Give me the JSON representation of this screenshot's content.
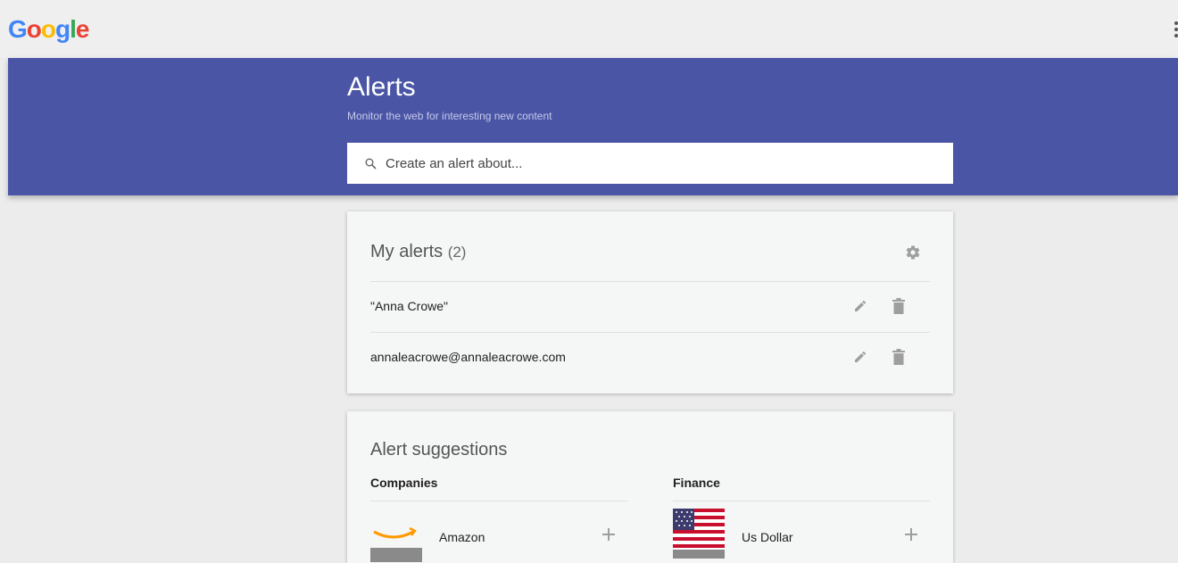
{
  "logo": {
    "letters": [
      "G",
      "o",
      "o",
      "g",
      "l",
      "e"
    ],
    "colors": [
      "#4285F4",
      "#EA4335",
      "#FBBC05",
      "#4285F4",
      "#34A853",
      "#EA4335"
    ]
  },
  "banner": {
    "title": "Alerts",
    "subtitle": "Monitor the web for interesting new content",
    "color": "#4a55a6"
  },
  "search": {
    "placeholder": "Create an alert about...",
    "icon": "search-icon"
  },
  "my_alerts": {
    "title": "My alerts",
    "count": "(2)",
    "settings_icon": "gear-icon",
    "items": [
      {
        "query": "\"Anna Crowe\"",
        "edit_icon": "pencil-icon",
        "delete_icon": "trash-icon"
      },
      {
        "query": "annaleacrowe@annaleacrowe.com",
        "edit_icon": "pencil-icon",
        "delete_icon": "trash-icon"
      }
    ]
  },
  "suggestions": {
    "title": "Alert suggestions",
    "columns": [
      {
        "heading": "Companies",
        "items": [
          {
            "name": "Amazon",
            "thumb": "amazon-logo"
          }
        ]
      },
      {
        "heading": "Finance",
        "items": [
          {
            "name": "Us Dollar",
            "thumb": "us-flag"
          }
        ]
      }
    ],
    "add_icon": "plus-icon"
  }
}
